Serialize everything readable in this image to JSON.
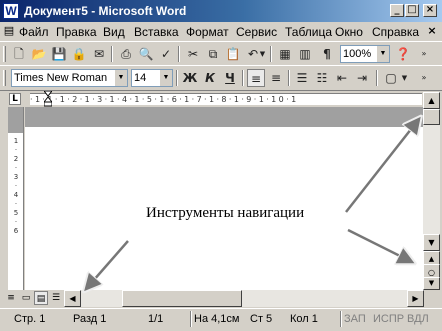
{
  "window": {
    "title": "Документ5 - Microsoft Word",
    "app_icon_letter": "W",
    "buttons": {
      "minimize": "_",
      "maximize": "□",
      "close": "×"
    }
  },
  "menu": {
    "items": [
      "Файл",
      "Правка",
      "Вид",
      "Вставка",
      "Формат",
      "Сервис",
      "Таблица",
      "Окно",
      "Справка"
    ]
  },
  "standard_toolbar": {
    "icons": [
      "new-document-icon",
      "open-folder-icon",
      "save-icon",
      "permission-icon",
      "email-icon",
      "print-icon",
      "print-preview-icon",
      "spelling-icon",
      "cut-icon",
      "copy-icon",
      "paste-icon",
      "format-painter-icon",
      "undo-icon",
      "table-icon",
      "columns-icon",
      "show-formatting-icon",
      "zoom-select",
      "help-icon"
    ],
    "pilcrow": "¶",
    "zoom_value": "100%"
  },
  "formatting_toolbar": {
    "font_name": "Times New Roman",
    "font_size": "14",
    "bold": "Ж",
    "italic": "К",
    "underline": "Ч"
  },
  "ruler": {
    "tab_marker": "L",
    "numbers": "·1·1·1·2·1·3·1·4·1·5·1·6·1·7·1·8·1·9·1·10·1"
  },
  "vertical_ruler": {
    "marks": [
      "1",
      "·",
      "2",
      "·",
      "3",
      "·",
      "4",
      "·",
      "5",
      "·",
      "6"
    ]
  },
  "document": {
    "annotation_text": "Инструменты навигации"
  },
  "status_bar": {
    "page": "Стр. 1",
    "section": "Разд 1",
    "pages": "1/1",
    "position": "На 4,1см",
    "line": "Ст 5",
    "column": "Кол 1",
    "modes": [
      "ЗАП",
      "ИСПР",
      "ВДЛ"
    ]
  },
  "colors": {
    "title_gradient_start": "#0a246a",
    "title_gradient_end": "#a6caf0",
    "chrome": "#d4d0c8",
    "page_gray": "#a0a0a0"
  }
}
